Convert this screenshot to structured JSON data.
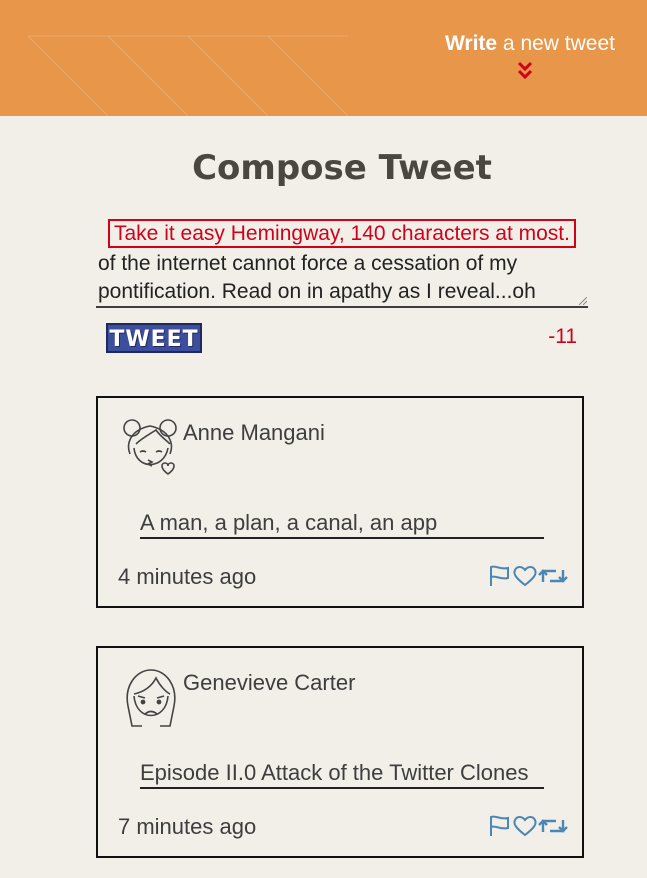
{
  "header": {
    "write_bold": "Write",
    "write_rest": " a new tweet",
    "text_color": "#ffffff",
    "background": "#e8964a",
    "icon": "double-chevron-down-icon"
  },
  "compose": {
    "title": "Compose Tweet",
    "warning": "Take it easy Hemingway, 140 characters at most.",
    "text_line1": "of the internet cannot force a cessation of my",
    "text_line2": "pontification. Read on in apathy as I reveal...oh",
    "button_label": "TWEET",
    "counter": "-11",
    "warning_color": "#d0021b"
  },
  "tweets": [
    {
      "name": "Anne Mangani",
      "text": "A man, a plan, a canal, an app",
      "time": "4 minutes ago",
      "avatar": "girl-kiss-avatar-icon"
    },
    {
      "name": "Genevieve Carter",
      "text": "Episode II.0 Attack of the Twitter Clones",
      "time": "7 minutes ago",
      "avatar": "girl-frown-avatar-icon"
    }
  ],
  "action_icons": [
    "flag-icon",
    "heart-icon",
    "retweet-icon"
  ],
  "action_color": "#4b86b4"
}
